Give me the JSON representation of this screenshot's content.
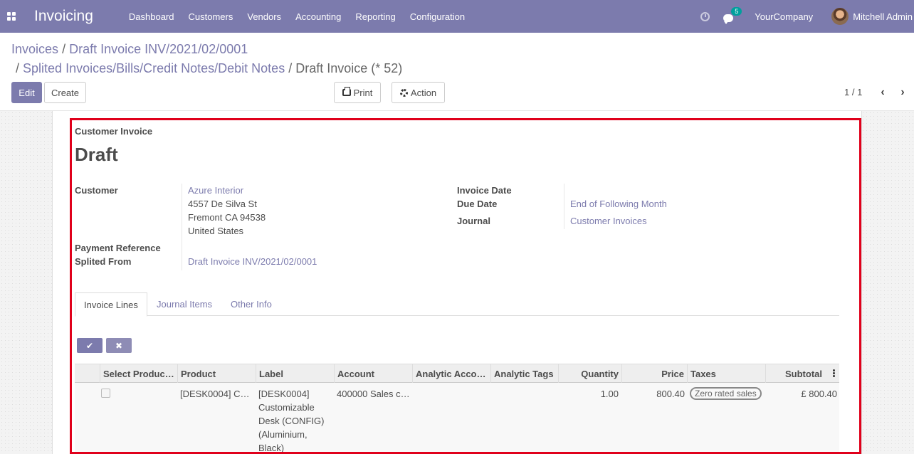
{
  "navbar": {
    "app_title": "Invoicing",
    "menu": [
      "Dashboard",
      "Customers",
      "Vendors",
      "Accounting",
      "Reporting",
      "Configuration"
    ],
    "messages_count": "5",
    "company": "YourCompany",
    "user": "Mitchell Admin",
    "bg_color": "#7c7bad"
  },
  "breadcrumb": {
    "items": [
      "Invoices",
      "Draft Invoice INV/2021/02/0001",
      "Splited Invoices/Bills/Credit Notes/Debit Notes",
      "Draft Invoice (* 52)"
    ],
    "separator": "/"
  },
  "toolbar": {
    "edit_label": "Edit",
    "create_label": "Create",
    "print_label": "Print",
    "action_label": "Action"
  },
  "pager": {
    "value": "1 / 1",
    "prev_icon": "chevron-left-icon",
    "next_icon": "chevron-right-icon"
  },
  "form": {
    "doc_type": "Customer Invoice",
    "status_title": "Draft",
    "customer_label": "Customer",
    "customer_name": "Azure Interior",
    "customer_address": [
      "4557 De Silva St",
      "Fremont CA 94538",
      "United States"
    ],
    "payment_reference_label": "Payment Reference",
    "splited_from_label": "Splited From",
    "splited_from_value": "Draft Invoice INV/2021/02/0001",
    "invoice_date_label": "Invoice Date",
    "due_date_label": "Due Date",
    "due_date_value": "End of Following Month",
    "journal_label": "Journal",
    "journal_value": "Customer Invoices"
  },
  "tabs": [
    "Invoice Lines",
    "Journal Items",
    "Other Info"
  ],
  "table": {
    "headers": [
      "Select Produc…",
      "Product",
      "Label",
      "Account",
      "Analytic Acco…",
      "Analytic Tags",
      "Quantity",
      "Price",
      "Taxes",
      "Subtotal"
    ],
    "rows": [
      {
        "product": "[DESK0004] C…",
        "label_lines": [
          "[DESK0004]",
          "Customizable",
          "Desk (CONFIG)",
          "(Aluminium,",
          "Black)"
        ],
        "account": "400000 Sales c…",
        "analytic_account": "",
        "analytic_tags": "",
        "quantity": "1.00",
        "price": "800.40",
        "tax_tag": "Zero rated sales",
        "subtotal": "£ 800.40"
      }
    ]
  },
  "accent_colors": {
    "highlight_frame": "#e0001b",
    "link": "#7c7bad"
  }
}
